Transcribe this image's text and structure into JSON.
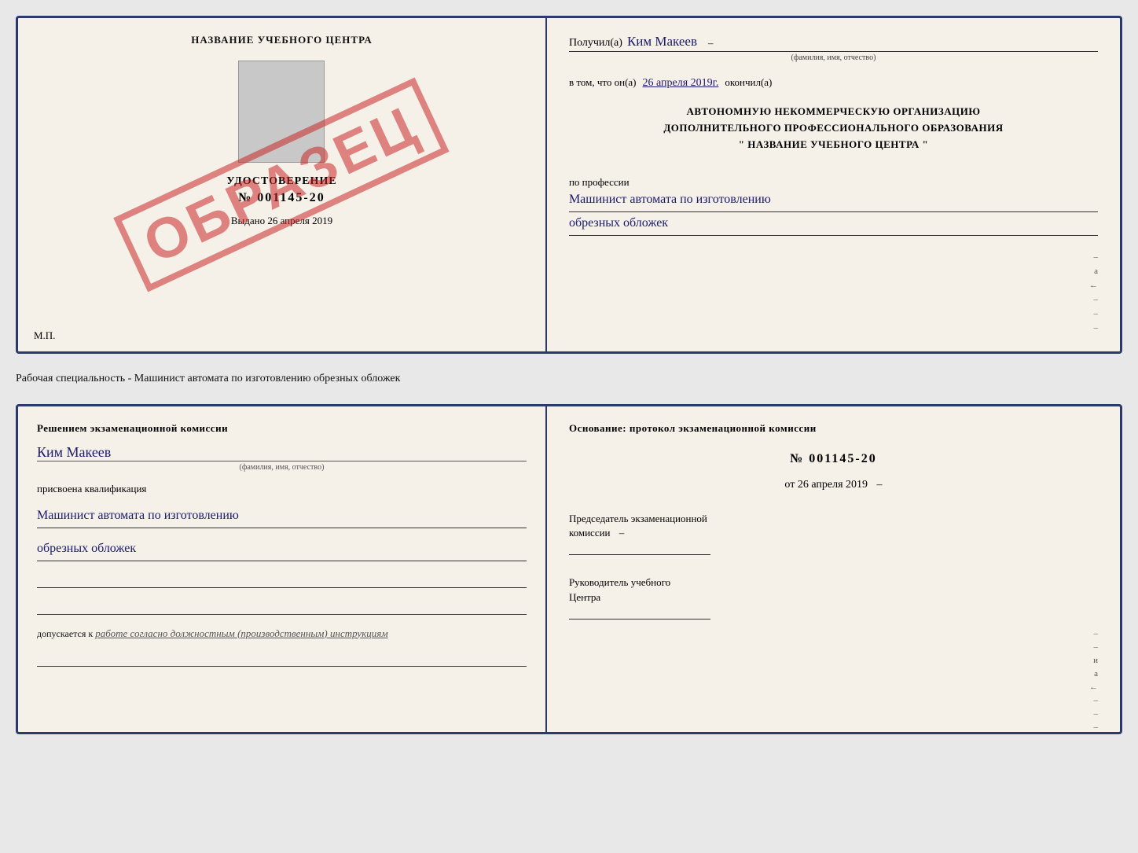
{
  "document": {
    "top": {
      "left": {
        "title": "НАЗВАНИЕ УЧЕБНОГО ЦЕНТРА",
        "photo_placeholder": true,
        "cert_label": "УДОСТОВЕРЕНИЕ",
        "cert_number": "№ 001145-20",
        "issued_text": "Выдано",
        "issued_date": "26 апреля 2019",
        "mp_label": "М.П.",
        "watermark": "ОБРАЗЕЦ"
      },
      "right": {
        "received_prefix": "Получил(а)",
        "recipient_name": "Ким Макеев",
        "fio_label": "(фамилия, имя, отчество)",
        "date_prefix": "в том, что он(а)",
        "date_value": "26 апреля 2019г.",
        "date_suffix": "окончил(а)",
        "org_line1": "АВТОНОМНУЮ НЕКОММЕРЧЕСКУЮ ОРГАНИЗАЦИЮ",
        "org_line2": "ДОПОЛНИТЕЛЬНОГО ПРОФЕССИОНАЛЬНОГО ОБРАЗОВАНИЯ",
        "org_line3": "\" НАЗВАНИЕ УЧЕБНОГО ЦЕНТРА \"",
        "profession_label": "по профессии",
        "profession_line1": "Машинист автомата по изготовлению",
        "profession_line2": "обрезных обложек"
      }
    },
    "middle_text": "Рабочая специальность - Машинист автомата по изготовлению обрезных обложек",
    "bottom": {
      "left": {
        "decision_text": "Решением экзаменационной комиссии",
        "person_name": "Ким Макеев",
        "fio_sub": "(фамилия, имя, отчество)",
        "qualification_label": "присвоена квалификация",
        "qualification_line1": "Машинист автомата по изготовлению",
        "qualification_line2": "обрезных обложек",
        "allowed_prefix": "допускается к",
        "allowed_text": "работе согласно должностным (производственным) инструкциям"
      },
      "right": {
        "basis_text": "Основание: протокол экзаменационной комиссии",
        "protocol_number": "№ 001145-20",
        "date_prefix": "от",
        "date_value": "26 апреля 2019",
        "chairman_label": "Председатель экзаменационной\nкомиссии",
        "director_label": "Руководитель учебного\nЦентра"
      }
    }
  }
}
